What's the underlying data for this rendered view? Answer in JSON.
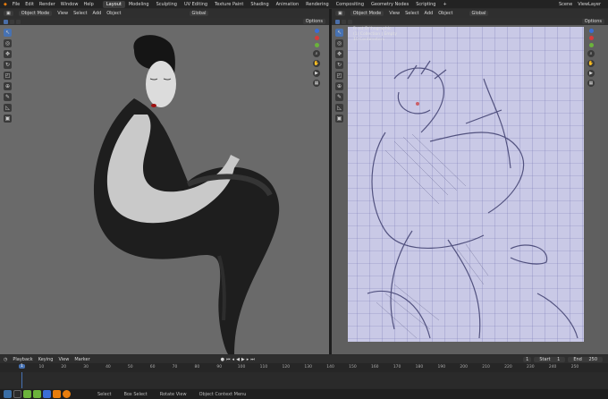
{
  "topbar": {
    "menu": [
      "File",
      "Edit",
      "Render",
      "Window",
      "Help"
    ],
    "workspaces": [
      "Layout",
      "Modeling",
      "Sculpting",
      "UV Editing",
      "Texture Paint",
      "Shading",
      "Animation",
      "Rendering",
      "Compositing",
      "Geometry Nodes",
      "Scripting"
    ],
    "active_workspace": "Layout",
    "scene": "Scene",
    "view_layer": "ViewLayer"
  },
  "left_view": {
    "mode": "Object Mode",
    "menus": [
      "View",
      "Select",
      "Add",
      "Object"
    ],
    "orientation": "Global",
    "options": "Options"
  },
  "right_view": {
    "mode": "Object Mode",
    "menus": [
      "View",
      "Select",
      "Add",
      "Object"
    ],
    "orientation": "Global",
    "options": "Options",
    "overlay_line1": "Front Orthographic",
    "overlay_line2": "(1) Collection | Empty",
    "overlay_line3": "10 Centimeters"
  },
  "timeline": {
    "menus": [
      "Playback",
      "Keying",
      "View",
      "Marker"
    ],
    "current_frame": "1",
    "start_label": "Start",
    "start": "1",
    "end_label": "End",
    "end": "250",
    "ticks": [
      "10",
      "20",
      "30",
      "40",
      "50",
      "60",
      "70",
      "80",
      "90",
      "100",
      "110",
      "120",
      "130",
      "140",
      "150",
      "160",
      "170",
      "180",
      "190",
      "200",
      "210",
      "220",
      "230",
      "240",
      "250"
    ]
  },
  "status": {
    "hints": [
      "Select",
      "Box Select",
      "Rotate View",
      "Object Context Menu"
    ]
  },
  "colors": {
    "accent": "#4772b3",
    "viewport_left": "#6a6a6a",
    "paper": "#c9c9e6"
  }
}
